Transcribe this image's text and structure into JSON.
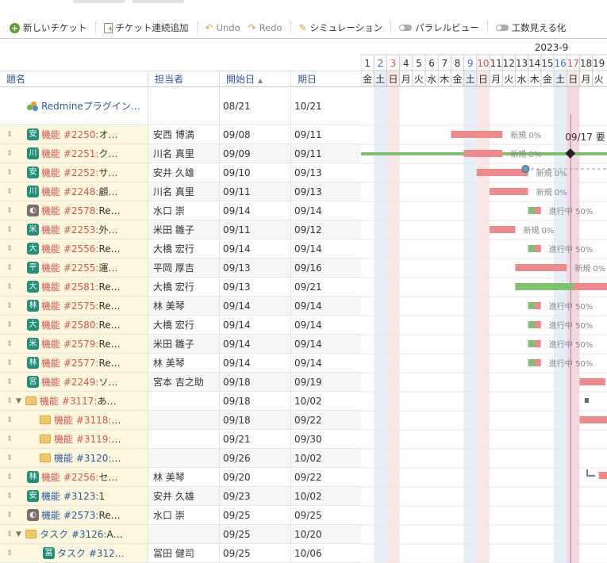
{
  "toolbar": {
    "new_ticket": "新しいチケット",
    "bulk_add": "チケット連続追加",
    "undo": "Undo",
    "redo": "Redo",
    "simulation": "シミュレーション",
    "parallel_view": "パラレルビュー",
    "effort_view": "工数見える化"
  },
  "columns": {
    "subject": "題名",
    "assignee": "担当者",
    "start": "開始日",
    "due": "期日"
  },
  "calendar": {
    "month": "2023-9",
    "days": [
      "1",
      "2",
      "3",
      "4",
      "5",
      "6",
      "7",
      "8",
      "9",
      "10",
      "11",
      "12",
      "13",
      "14",
      "15",
      "16",
      "17",
      "18",
      "19"
    ],
    "weekdays": [
      "金",
      "土",
      "日",
      "月",
      "火",
      "水",
      "木",
      "金",
      "土",
      "日",
      "月",
      "火",
      "水",
      "木",
      "金",
      "土",
      "日",
      "月",
      "火"
    ],
    "weekend_text_color": "#3a6ec8",
    "holiday_text_color": "#d9534f",
    "today_label": "09/17 要"
  },
  "colors": {
    "late_bar": "#f08a8a",
    "done_bar": "#7cc46a",
    "project_bar": "#7cc46a",
    "today_line": "#c070b0",
    "saturday_bg": "#e6eefa",
    "sunday_bg": "#fbe6e6"
  },
  "rows": [
    {
      "kind": "project",
      "icon": "project-icon",
      "subject": "Redmineプラグイン…",
      "assignee": "",
      "start": "08/21",
      "due": "10/21"
    },
    {
      "kind": "issue",
      "badge": "安",
      "badge_style": "letter",
      "tracker": "機能 #2250:",
      "tracker_color": "red",
      "title": " オ…",
      "assignee": "安西 博満",
      "start": "09/08",
      "due": "09/11",
      "bar": {
        "from": 8,
        "to": 11,
        "progress": 0,
        "label": "新規 0%"
      }
    },
    {
      "kind": "issue",
      "badge": "川",
      "badge_style": "letter",
      "tracker": "機能 #2251:",
      "tracker_color": "red",
      "title": " ク…",
      "assignee": "川名 真里",
      "start": "09/09",
      "due": "09/11",
      "bar": {
        "from": 9,
        "to": 11,
        "progress": 0,
        "label": "新規 0%"
      }
    },
    {
      "kind": "issue",
      "badge": "安",
      "badge_style": "letter",
      "tracker": "機能 #2252:",
      "tracker_color": "red",
      "title": " サ…",
      "assignee": "安井 久雄",
      "start": "09/10",
      "due": "09/13",
      "bar": {
        "from": 10,
        "to": 13,
        "progress": 0,
        "label": "新規 0%"
      }
    },
    {
      "kind": "issue",
      "badge": "川",
      "badge_style": "letter",
      "tracker": "機能 #2248:",
      "tracker_color": "red",
      "title": " 顧…",
      "assignee": "川名 真里",
      "start": "09/11",
      "due": "09/13",
      "bar": {
        "from": 11,
        "to": 13,
        "progress": 0,
        "label": "新規 0%"
      }
    },
    {
      "kind": "issue",
      "badge": "",
      "badge_style": "photo",
      "tracker": "機能 #2578:",
      "tracker_color": "red",
      "title": " Re…",
      "assignee": "水口 崇",
      "start": "09/14",
      "due": "09/14",
      "bar": {
        "from": 14,
        "to": 14,
        "progress": 50,
        "label": "進行中 50%"
      }
    },
    {
      "kind": "issue",
      "badge": "米",
      "badge_style": "letter",
      "tracker": "機能 #2253:",
      "tracker_color": "red",
      "title": " 外…",
      "assignee": "米田 雛子",
      "start": "09/11",
      "due": "09/12",
      "bar": {
        "from": 11,
        "to": 12,
        "progress": 0,
        "label": "新規 0%"
      }
    },
    {
      "kind": "issue",
      "badge": "大",
      "badge_style": "letter",
      "tracker": "機能 #2556:",
      "tracker_color": "red",
      "title": " Re…",
      "assignee": "大橋 宏行",
      "start": "09/14",
      "due": "09/14",
      "bar": {
        "from": 14,
        "to": 14,
        "progress": 50,
        "label": "進行中 50%"
      }
    },
    {
      "kind": "issue",
      "badge": "平",
      "badge_style": "letter",
      "tracker": "機能 #2255:",
      "tracker_color": "red",
      "title": " 運…",
      "assignee": "平岡 厚吉",
      "start": "09/13",
      "due": "09/16",
      "bar": {
        "from": 13,
        "to": 16,
        "progress": 0,
        "label": "新規 0%"
      }
    },
    {
      "kind": "issue",
      "badge": "大",
      "badge_style": "letter",
      "tracker": "機能 #2581:",
      "tracker_color": "red",
      "title": " Re…",
      "assignee": "大橋 宏行",
      "start": "09/13",
      "due": "09/21",
      "bar": {
        "from": 13,
        "to": 21,
        "progress": 50,
        "label": ""
      }
    },
    {
      "kind": "issue",
      "badge": "林",
      "badge_style": "letter",
      "tracker": "機能 #2575:",
      "tracker_color": "red",
      "title": " Re…",
      "assignee": "林 美琴",
      "start": "09/14",
      "due": "09/14",
      "bar": {
        "from": 14,
        "to": 14,
        "progress": 50,
        "label": "進行中 50%"
      }
    },
    {
      "kind": "issue",
      "badge": "大",
      "badge_style": "letter",
      "tracker": "機能 #2580:",
      "tracker_color": "red",
      "title": " Re…",
      "assignee": "大橋 宏行",
      "start": "09/14",
      "due": "09/14",
      "bar": {
        "from": 14,
        "to": 14,
        "progress": 50,
        "label": "進行中 50%"
      }
    },
    {
      "kind": "issue",
      "badge": "米",
      "badge_style": "letter",
      "tracker": "機能 #2579:",
      "tracker_color": "red",
      "title": " Re…",
      "assignee": "米田 雛子",
      "start": "09/14",
      "due": "09/14",
      "bar": {
        "from": 14,
        "to": 14,
        "progress": 50,
        "label": "進行中 50%"
      }
    },
    {
      "kind": "issue",
      "badge": "林",
      "badge_style": "letter",
      "tracker": "機能 #2577:",
      "tracker_color": "red",
      "title": " Re…",
      "assignee": "林 美琴",
      "start": "09/14",
      "due": "09/14",
      "bar": {
        "from": 14,
        "to": 14,
        "progress": 50,
        "label": "進行中 50%"
      }
    },
    {
      "kind": "issue",
      "badge": "宮",
      "badge_style": "letter",
      "tracker": "機能 #2249:",
      "tracker_color": "red",
      "title": " ソ…",
      "assignee": "宮本 吉之助",
      "start": "09/18",
      "due": "09/19",
      "bar": {
        "from": 18,
        "to": 19,
        "progress": 0,
        "label": ""
      }
    },
    {
      "kind": "parent",
      "indent": 0,
      "tracker": "機能 #3117:",
      "tracker_color": "red",
      "title": " あ…",
      "assignee": "",
      "start": "09/18",
      "due": "10/02"
    },
    {
      "kind": "child",
      "indent": 1,
      "tracker": "機能 #3118:",
      "tracker_color": "red",
      "title": " …",
      "assignee": "",
      "start": "09/18",
      "due": "09/22",
      "bar": {
        "from": 18,
        "to": 22,
        "progress": 0,
        "label": ""
      }
    },
    {
      "kind": "child",
      "indent": 1,
      "tracker": "機能 #3119:",
      "tracker_color": "red",
      "title": " …",
      "assignee": "",
      "start": "09/21",
      "due": "09/30"
    },
    {
      "kind": "child",
      "indent": 1,
      "tracker": "機能 #3120:",
      "tracker_color": "blue",
      "title": " …",
      "assignee": "",
      "start": "09/26",
      "due": "10/02"
    },
    {
      "kind": "issue",
      "badge": "林",
      "badge_style": "letter",
      "tracker": "機能 #2256:",
      "tracker_color": "red",
      "title": " セ…",
      "assignee": "林 美琴",
      "start": "09/20",
      "due": "09/22"
    },
    {
      "kind": "issue",
      "badge": "安",
      "badge_style": "letter",
      "tracker": "機能 #3123:",
      "tracker_color": "blue",
      "title": " 1",
      "assignee": "安井 久雄",
      "start": "09/23",
      "due": "10/02"
    },
    {
      "kind": "issue",
      "badge": "",
      "badge_style": "photo",
      "tracker": "機能 #2573:",
      "tracker_color": "blue",
      "title": " Re…",
      "assignee": "水口 崇",
      "start": "09/25",
      "due": "09/25"
    },
    {
      "kind": "parent",
      "indent": 0,
      "tracker": "タスク #3126:",
      "tracker_color": "blue",
      "title": " A…",
      "assignee": "",
      "start": "09/25",
      "due": "10/20"
    },
    {
      "kind": "issue",
      "indent": 1,
      "badge": "冨",
      "badge_style": "letter",
      "tracker": "タスク #312…",
      "tracker_color": "blue",
      "title": "",
      "assignee": "冨田 健司",
      "start": "09/25",
      "due": "10/06"
    }
  ]
}
